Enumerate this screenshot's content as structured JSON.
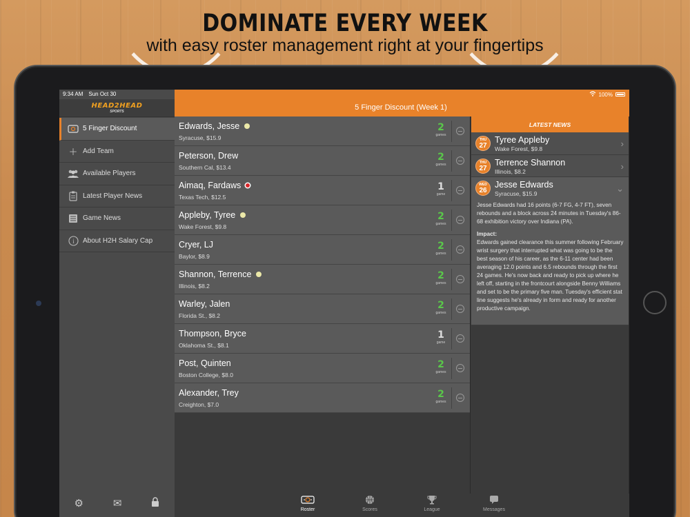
{
  "promo": {
    "headline": "DOMINATE EVERY WEEK",
    "subline": "with easy roster management right at your fingertips"
  },
  "status_bar": {
    "time": "9:34 AM",
    "date": "Sun Oct 30",
    "battery": "100%"
  },
  "app": {
    "logo": "HEAD2HEAD",
    "logo_sub": "SPORTS",
    "title": "5 Finger Discount   (Week 1)"
  },
  "sidebar": {
    "items": [
      {
        "label": "5 Finger Discount",
        "icon": "hoop-icon",
        "active": true
      },
      {
        "label": "Add Team",
        "icon": "plus-icon"
      },
      {
        "label": "Available Players",
        "icon": "players-icon"
      },
      {
        "label": "Latest Player News",
        "icon": "clipboard-icon"
      },
      {
        "label": "Game News",
        "icon": "newspaper-icon"
      },
      {
        "label": "About H2H Salary Cap",
        "icon": "info-icon"
      }
    ],
    "footer_icons": [
      "gear-icon",
      "mail-icon",
      "lock-icon"
    ]
  },
  "roster": [
    {
      "name": "Edwards, Jesse",
      "school_salary": "Syracuse, $15.9",
      "games": "2",
      "games_label": "games",
      "news_dot": "yellow"
    },
    {
      "name": "Peterson, Drew",
      "school_salary": "Southern Cal, $13.4",
      "games": "2",
      "games_label": "games",
      "news_dot": ""
    },
    {
      "name": "Aimaq, Fardaws",
      "school_salary": "Texas Tech, $12.5",
      "games": "1",
      "games_label": "game",
      "news_dot": "red"
    },
    {
      "name": "Appleby, Tyree",
      "school_salary": "Wake Forest, $9.8",
      "games": "2",
      "games_label": "games",
      "news_dot": "yellow"
    },
    {
      "name": "Cryer, LJ",
      "school_salary": "Baylor, $8.9",
      "games": "2",
      "games_label": "games",
      "news_dot": ""
    },
    {
      "name": "Shannon, Terrence",
      "school_salary": "Illinois, $8.2",
      "games": "2",
      "games_label": "games",
      "news_dot": "yellow"
    },
    {
      "name": "Warley, Jalen",
      "school_salary": "Florida St., $8.2",
      "games": "2",
      "games_label": "games",
      "news_dot": ""
    },
    {
      "name": "Thompson, Bryce",
      "school_salary": "Oklahoma St., $8.1",
      "games": "1",
      "games_label": "game",
      "news_dot": ""
    },
    {
      "name": "Post, Quinten",
      "school_salary": "Boston College, $8.0",
      "games": "2",
      "games_label": "games",
      "news_dot": ""
    },
    {
      "name": "Alexander, Trey",
      "school_salary": "Creighton, $7.0",
      "games": "2",
      "games_label": "games",
      "news_dot": ""
    }
  ],
  "news": {
    "header": "LATEST NEWS",
    "items": [
      {
        "day": "THU",
        "date": "27",
        "name": "Tyree Appleby",
        "sub": "Wake Forest, $9.8"
      },
      {
        "day": "THU",
        "date": "27",
        "name": "Terrence Shannon",
        "sub": "Illinois, $8.2"
      },
      {
        "day": "WED",
        "date": "26",
        "name": "Jesse Edwards",
        "sub": "Syracuse, $15.9",
        "body": "Jesse Edwards had 16 points (6-7 FG, 4-7 FT), seven rebounds and a block across 24 minutes in Tuesday's 86-68 exhibition victory over Indiana (PA).",
        "impact_label": "Impact:",
        "impact": "Edwards gained clearance this summer following February wrist surgery that interrupted what was going to be the best season of his career, as the 6-11 center had been averaging 12.0 points and 6.5 rebounds through the first 24 games. He's now back and ready to pick up where he left off, starting in the frontcourt alongside Benny Williams and set to be the primary five man. Tuesday's efficient stat line suggests he's already in form and ready for another productive campaign."
      }
    ]
  },
  "tabs": [
    {
      "label": "Roster",
      "icon": "hoop-icon",
      "active": true
    },
    {
      "label": "Scores",
      "icon": "basketball-icon"
    },
    {
      "label": "League",
      "icon": "trophy-icon"
    },
    {
      "label": "Messages",
      "icon": "chat-icon"
    }
  ],
  "colors": {
    "accent": "#e8822a",
    "games_two": "#5ac84a",
    "dot_yellow": "#ebe8a8",
    "dot_red": "#d8262a"
  }
}
